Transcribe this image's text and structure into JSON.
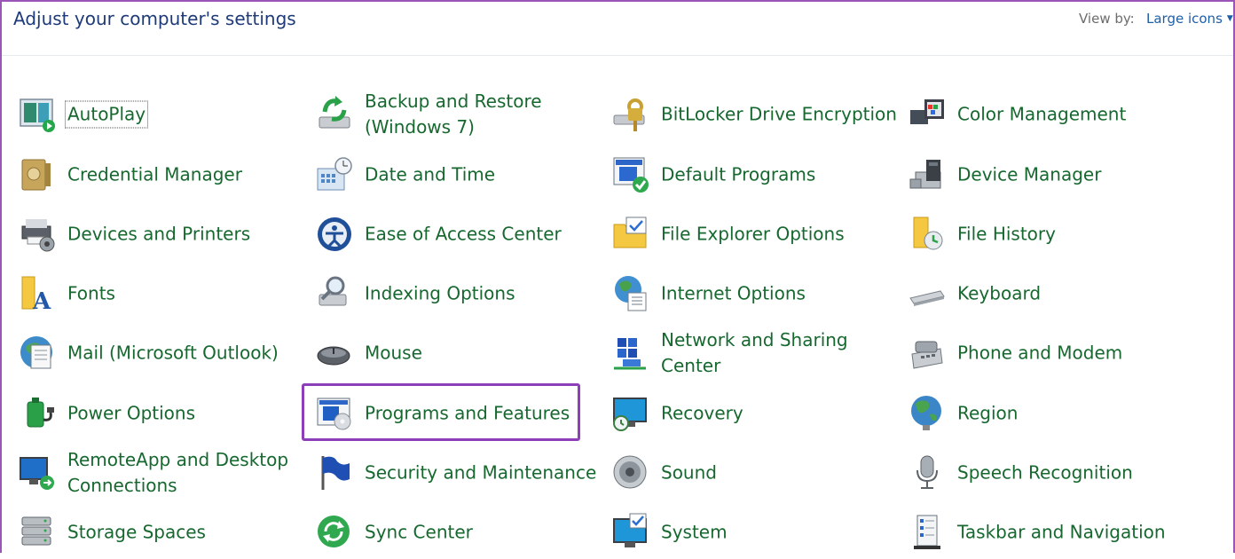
{
  "header": {
    "title": "Adjust your computer's settings",
    "view_by_label": "View by:",
    "view_by_value": "Large icons"
  },
  "highlighted_item": "Programs and Features",
  "items": [
    {
      "label": "AutoPlay",
      "icon": "autoplay-icon"
    },
    {
      "label": "Backup and Restore\n(Windows 7)",
      "icon": "backup-restore-icon"
    },
    {
      "label": "BitLocker Drive Encryption",
      "icon": "bitlocker-icon"
    },
    {
      "label": "Color Management",
      "icon": "color-management-icon"
    },
    {
      "label": "Credential Manager",
      "icon": "credential-manager-icon"
    },
    {
      "label": "Date and Time",
      "icon": "date-time-icon"
    },
    {
      "label": "Default Programs",
      "icon": "default-programs-icon"
    },
    {
      "label": "Device Manager",
      "icon": "device-manager-icon"
    },
    {
      "label": "Devices and Printers",
      "icon": "devices-printers-icon"
    },
    {
      "label": "Ease of Access Center",
      "icon": "ease-of-access-icon"
    },
    {
      "label": "File Explorer Options",
      "icon": "file-explorer-options-icon"
    },
    {
      "label": "File History",
      "icon": "file-history-icon"
    },
    {
      "label": "Fonts",
      "icon": "fonts-icon"
    },
    {
      "label": "Indexing Options",
      "icon": "indexing-options-icon"
    },
    {
      "label": "Internet Options",
      "icon": "internet-options-icon"
    },
    {
      "label": "Keyboard",
      "icon": "keyboard-icon"
    },
    {
      "label": "Mail (Microsoft Outlook)",
      "icon": "mail-icon"
    },
    {
      "label": "Mouse",
      "icon": "mouse-icon"
    },
    {
      "label": "Network and Sharing\nCenter",
      "icon": "network-sharing-icon"
    },
    {
      "label": "Phone and Modem",
      "icon": "phone-modem-icon"
    },
    {
      "label": "Power Options",
      "icon": "power-options-icon"
    },
    {
      "label": "Programs and Features",
      "icon": "programs-features-icon"
    },
    {
      "label": "Recovery",
      "icon": "recovery-icon"
    },
    {
      "label": "Region",
      "icon": "region-icon"
    },
    {
      "label": "RemoteApp and Desktop\nConnections",
      "icon": "remoteapp-icon"
    },
    {
      "label": "Security and Maintenance",
      "icon": "security-maintenance-icon"
    },
    {
      "label": "Sound",
      "icon": "sound-icon"
    },
    {
      "label": "Speech Recognition",
      "icon": "speech-recognition-icon"
    },
    {
      "label": "Storage Spaces",
      "icon": "storage-spaces-icon"
    },
    {
      "label": "Sync Center",
      "icon": "sync-center-icon"
    },
    {
      "label": "System",
      "icon": "system-icon"
    },
    {
      "label": "Taskbar and Navigation",
      "icon": "taskbar-navigation-icon"
    }
  ],
  "colors": {
    "title": "#1e3a78",
    "item_text": "#16682f",
    "link": "#1f5fa5",
    "highlight": "#8d3fba"
  }
}
